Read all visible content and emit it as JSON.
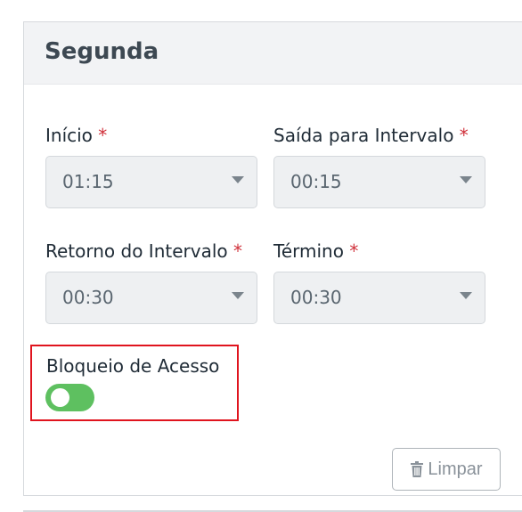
{
  "card": {
    "title": "Segunda"
  },
  "fields": {
    "inicio": {
      "label": "Início",
      "required_mark": "*",
      "value": "01:15"
    },
    "saida_intervalo": {
      "label": "Saída para Intervalo",
      "required_mark": "*",
      "value": "00:15"
    },
    "retorno_intervalo": {
      "label": "Retorno do Intervalo",
      "required_mark": "*",
      "value": "00:30"
    },
    "termino": {
      "label": "Término",
      "required_mark": "*",
      "value": "00:30"
    }
  },
  "toggle": {
    "label": "Bloqueio de Acesso",
    "state": "on"
  },
  "actions": {
    "clear_label": "Limpar",
    "clear_icon": "trash-icon"
  },
  "colors": {
    "toggle_on": "#5ec060",
    "required": "#d0303a",
    "highlight": "#e0141e"
  }
}
